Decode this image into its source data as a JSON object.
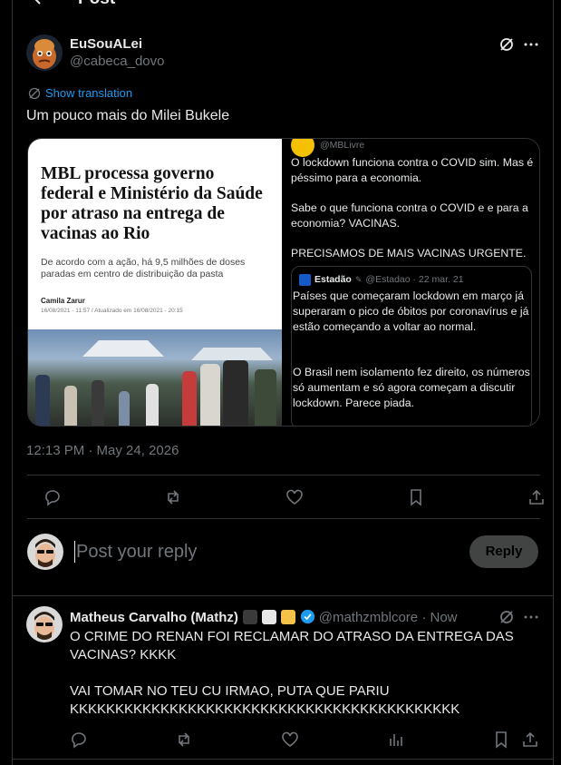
{
  "header": {
    "title": "Post"
  },
  "post": {
    "author_name": "EuSouALei",
    "author_handle": "@cabeca_dovo",
    "translate_label": "Show translation",
    "text": "Um pouco mais do Milei Bukele",
    "timestamp": "12:13 PM · May 24, 2026"
  },
  "media": {
    "news": {
      "headline": "MBL processa governo federal e Ministério da Saúde por atraso na entrega de vacinas ao Rio",
      "subtitle": "De acordo com a ação, há 9,5 milhões de doses paradas em centro de distribuição da pasta",
      "author": "Camila Zarur",
      "date": "16/08/2021 - 11:57 / Atualizado em 16/08/2021 - 20:15"
    },
    "tweet": {
      "handle": "@MBLivre",
      "p1": "O lockdown funciona contra o COVID sim. Mas é péssimo para a economia.",
      "p2": "Sabe o que funciona contra o COVID e e para a economia? VACINAS.",
      "p3": "PRECISAMOS DE MAIS VACINAS URGENTE.",
      "quote_name": "Estadão",
      "quote_meta": "@Estadao · 22 mar. 21",
      "quote_p1": "Países que começaram lockdown em março já superaram o pico de óbitos por coronavírus e já estão começando a voltar ao normal.",
      "quote_p2": "O Brasil nem isolamento fez direito, os números só aumentam e só agora começam a discutir lockdown. Parece piada."
    }
  },
  "composer": {
    "placeholder": "Post your reply",
    "button": "Reply"
  },
  "reply": {
    "author_name": "Matheus Carvalho (Mathz)",
    "author_handle": "@mathzmblcore",
    "time": "· Now",
    "line1": "O CRIME DO RENAN FOI RECLAMAR DO ATRASO DA ENTREGA DAS VACINAS? KKKK",
    "line2": "VAI TOMAR NO TEU CU IRMAO, PUTA QUE PARIU KKKKKKKKKKKKKKKKKKKKKKKKKKKKKKKKKKKKKKKKKKK"
  },
  "colors": {
    "accent": "#1d9bf0",
    "muted": "#71767b",
    "border": "#2f3336",
    "background": "#000000"
  }
}
